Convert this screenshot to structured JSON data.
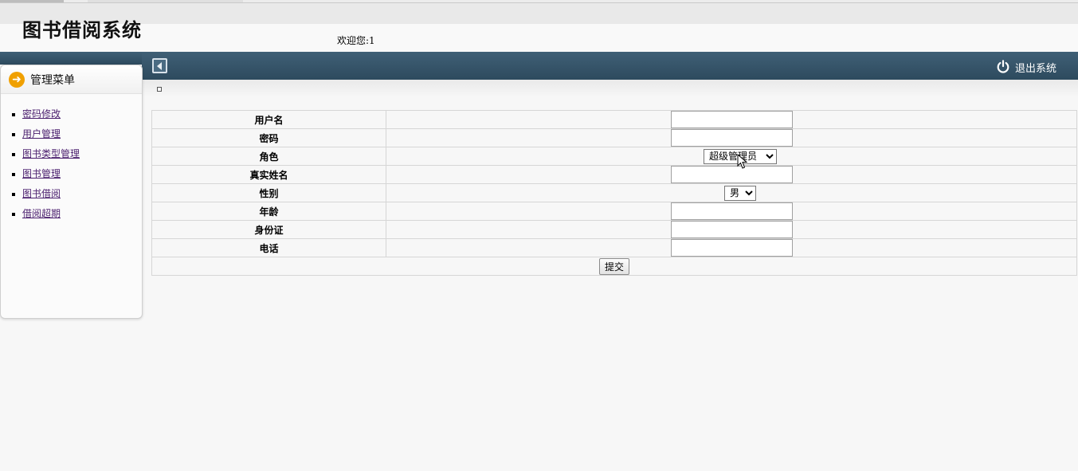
{
  "app": {
    "title": "图书借阅系统",
    "welcome_label": "欢迎您:",
    "username": "1"
  },
  "topbar": {
    "logout_label": "退出系统"
  },
  "sidebar": {
    "heading": "管理菜单",
    "items": [
      {
        "label": "密码修改"
      },
      {
        "label": "用户管理"
      },
      {
        "label": "图书类型管理"
      },
      {
        "label": "图书管理"
      },
      {
        "label": "图书借阅"
      },
      {
        "label": "借阅超期"
      }
    ]
  },
  "form": {
    "fields": {
      "username": {
        "label": "用户名",
        "value": ""
      },
      "password": {
        "label": "密码",
        "value": ""
      },
      "role": {
        "label": "角色",
        "selected": "超级管理员"
      },
      "realname": {
        "label": "真实姓名",
        "value": ""
      },
      "gender": {
        "label": "性别",
        "selected": "男"
      },
      "age": {
        "label": "年龄",
        "value": ""
      },
      "idcard": {
        "label": "身份证",
        "value": ""
      },
      "phone": {
        "label": "电话",
        "value": ""
      }
    },
    "submit_label": "提交"
  },
  "colors": {
    "topbar": "#34536a",
    "accent": "#f0a000",
    "link": "#4a1e6e"
  }
}
